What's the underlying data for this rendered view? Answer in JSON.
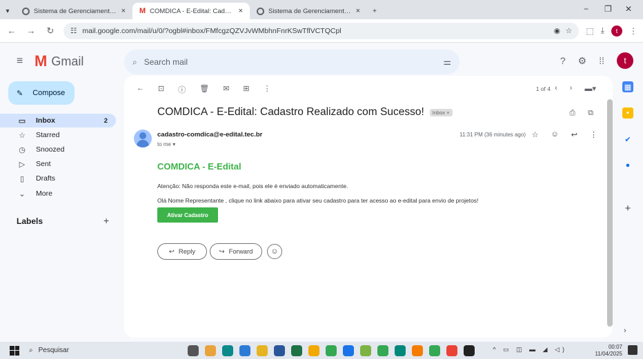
{
  "browser": {
    "tabs": [
      {
        "label": "Sistema de Gerenciamento de",
        "active": false
      },
      {
        "label": "COMDICA - E-Edital: Cadastro R",
        "active": true
      },
      {
        "label": "Sistema de Gerenciamento de",
        "active": false
      }
    ],
    "url": "mail.google.com/mail/u/0/?ogbl#inbox/FMfcgzQZVJvWMbhnFnrKSwTflVCTQCpl",
    "profile_letter": "t"
  },
  "gmail": {
    "logo_text": "Gmail",
    "search_placeholder": "Search mail",
    "avatar_letter": "t",
    "compose_label": "Compose",
    "nav": [
      {
        "label": "Inbox",
        "count": "2",
        "icon": "inbox-icon"
      },
      {
        "label": "Starred",
        "count": "",
        "icon": "star-icon"
      },
      {
        "label": "Snoozed",
        "count": "",
        "icon": "clock-icon"
      },
      {
        "label": "Sent",
        "count": "",
        "icon": "send-icon"
      },
      {
        "label": "Drafts",
        "count": "",
        "icon": "draft-icon"
      },
      {
        "label": "More",
        "count": "",
        "icon": "chevron-down-icon"
      }
    ],
    "labels_title": "Labels"
  },
  "message": {
    "page_info": "1 of 4",
    "subject": "COMDICA - E-Edital: Cadastro Realizado com Sucesso!",
    "inbox_tag": "Inbox ×",
    "from": "cadastro-comdica@e-edital.tec.br",
    "to": "to me ▾",
    "time": "11:31 PM (36 minutes ago)",
    "brand": "COMDICA - E-Edital",
    "para1": "Atenção: Não responda este e-mail, pois ele é enviado automaticamente.",
    "para2": "Olá Nome Representante , clique no link abaixo para ativar seu cadastro para ter acesso ao e-edital para envio de projetos!",
    "button": "Ativar Cadastro",
    "reply": "Reply",
    "forward": "Forward"
  },
  "taskbar": {
    "search": "Pesquisar",
    "time": "00:07",
    "date": "11/04/2025"
  },
  "colors": {
    "accent_green": "#3db34a",
    "active_nav": "#d3e3fd",
    "compose": "#c2e7ff"
  }
}
